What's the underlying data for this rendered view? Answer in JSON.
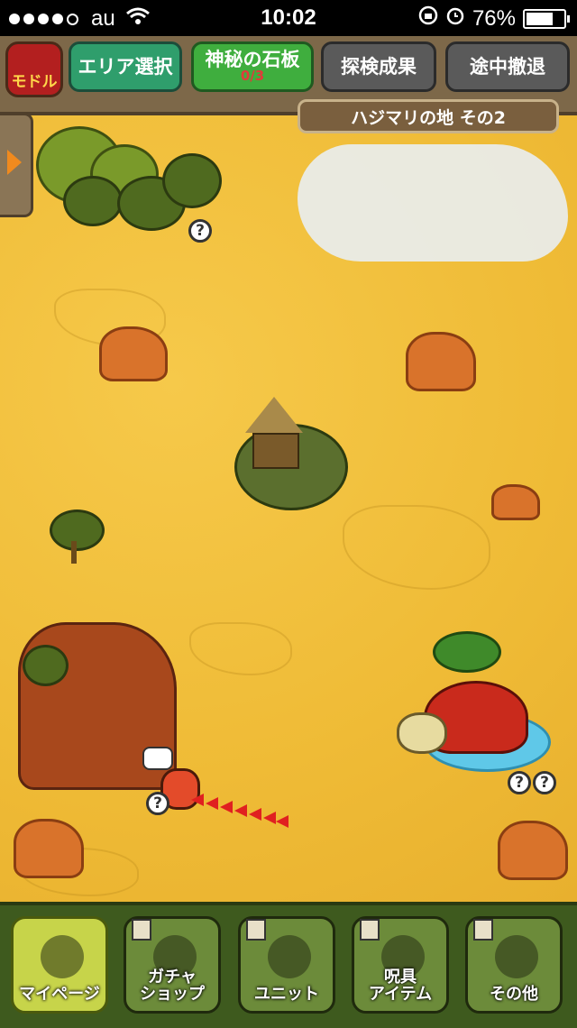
{
  "status_bar": {
    "carrier": "au",
    "time": "10:02",
    "battery": "76%",
    "battery_level": 0.76
  },
  "header": {
    "back_label": "モドル",
    "buttons": [
      {
        "label": "エリア選択"
      },
      {
        "label": "神秘の石板",
        "sub": "0/3"
      },
      {
        "label": "探検成果"
      },
      {
        "label": "途中撤退"
      }
    ],
    "area_name": "ハジマリの地 その2"
  },
  "map": {
    "question_mark": "?"
  },
  "bottom_nav": [
    {
      "label": "マイページ",
      "icon": "house-icon",
      "active": true
    },
    {
      "label": "ガチャ\nショップ",
      "icon": "shop-icon",
      "active": false
    },
    {
      "label": "ユニット",
      "icon": "monster-face-icon",
      "active": false
    },
    {
      "label": "呪具\nアイテム",
      "icon": "item-pouch-icon",
      "active": false
    },
    {
      "label": "その他",
      "icon": "exclamation-icon",
      "active": false
    }
  ],
  "colors": {
    "sand": "#efbb36",
    "header_bg": "#7d6849",
    "nav_bg": "#3e5a1e",
    "green_button": "#2f9e6c",
    "gray_button": "#5a5a5a",
    "path_arrow": "#e02020"
  }
}
